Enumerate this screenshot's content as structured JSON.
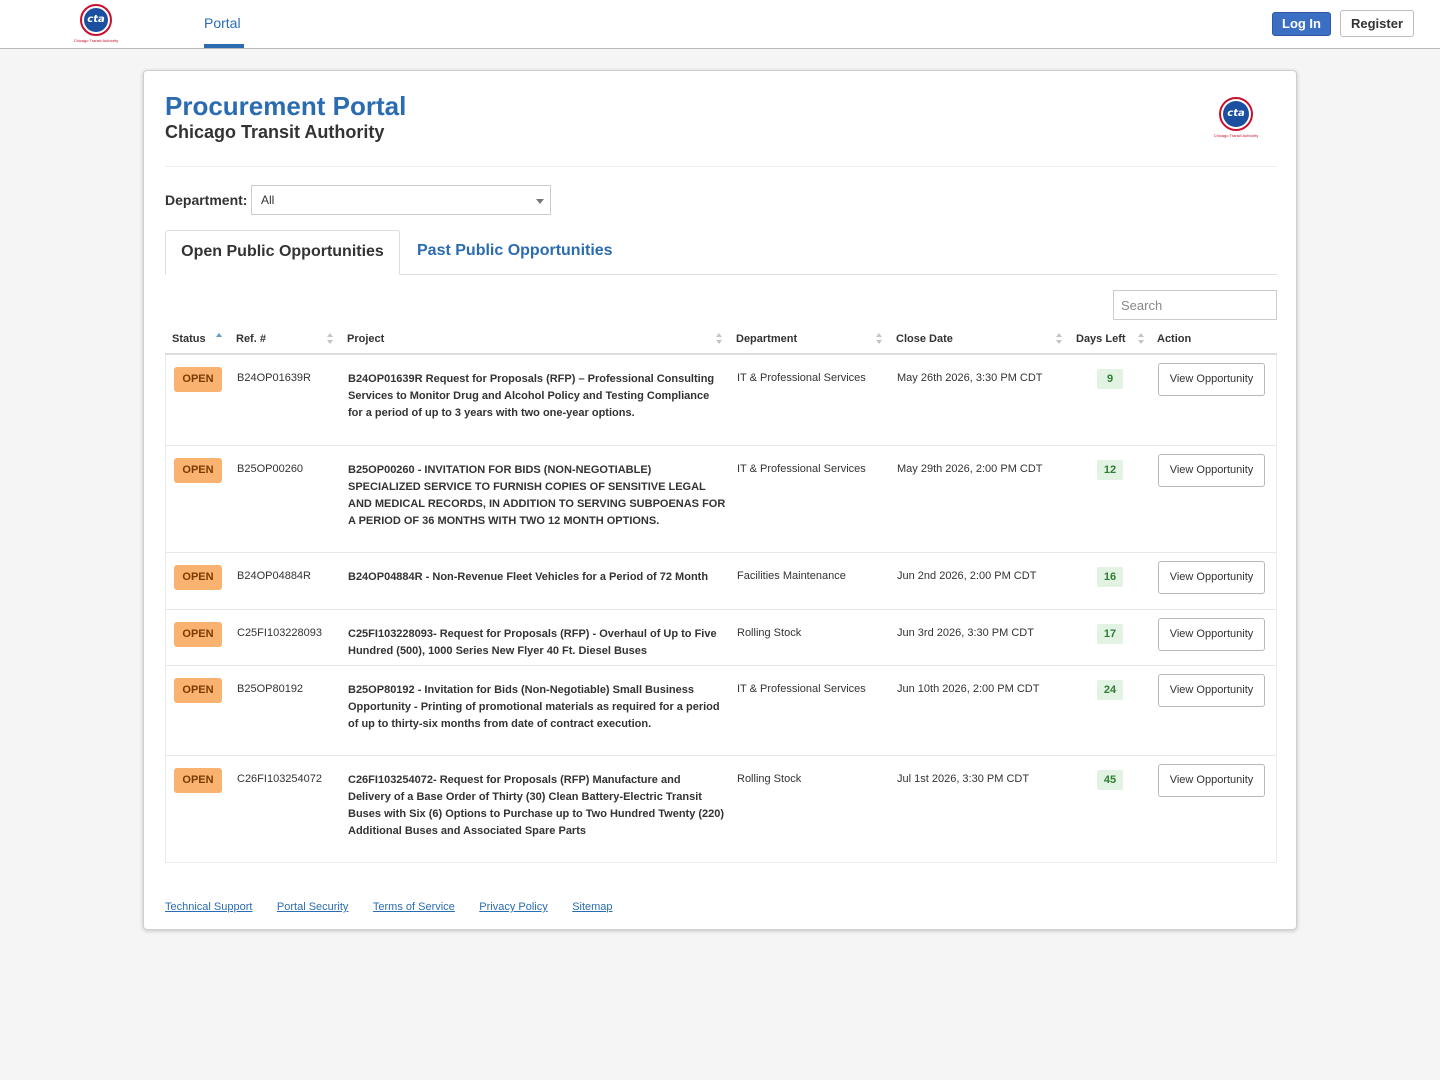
{
  "header": {
    "logo_text": "cta",
    "logo_caption": "Chicago Transit Authority",
    "nav_portal": "Portal",
    "login_label": "Log In",
    "register_label": "Register"
  },
  "page": {
    "title": "Procurement Portal",
    "subtitle": "Chicago Transit Authority"
  },
  "filter": {
    "department_label": "Department:",
    "department_value": "All"
  },
  "tabs": {
    "open": "Open Public Opportunities",
    "past": "Past Public Opportunities"
  },
  "search": {
    "placeholder": "Search"
  },
  "table": {
    "columns": {
      "status": "Status",
      "ref": "Ref. #",
      "project": "Project",
      "department": "Department",
      "close_date": "Close Date",
      "days_left": "Days Left",
      "action": "Action"
    },
    "rows": [
      {
        "status": "OPEN",
        "ref": "B24OP01639R",
        "project": "B24OP01639R Request for Proposals (RFP) – Professional Consulting Services to Monitor Drug and Alcohol Policy and Testing Compliance for a period of up to 3 years with two one-year options.",
        "department": "IT & Professional Services",
        "close_date": "May 26th 2026, 3:30 PM CDT",
        "days_left": "9",
        "action": "View Opportunity"
      },
      {
        "status": "OPEN",
        "ref": "B25OP00260",
        "project": "B25OP00260 - INVITATION FOR BIDS (NON-NEGOTIABLE) SPECIALIZED SERVICE TO FURNISH COPIES OF SENSITIVE LEGAL AND MEDICAL RECORDS, IN ADDITION TO SERVING SUBPOENAS FOR A PERIOD OF 36 MONTHS WITH TWO 12 MONTH OPTIONS.",
        "department": "IT & Professional Services",
        "close_date": "May 29th 2026, 2:00 PM CDT",
        "days_left": "12",
        "action": "View Opportunity"
      },
      {
        "status": "OPEN",
        "ref": "B24OP04884R",
        "project": "B24OP04884R - Non-Revenue Fleet Vehicles for a Period of 72 Month",
        "department": "Facilities Maintenance",
        "close_date": "Jun 2nd 2026, 2:00 PM CDT",
        "days_left": "16",
        "action": "View Opportunity"
      },
      {
        "status": "OPEN",
        "ref": "C25FI103228093",
        "project": "C25FI103228093- Request for Proposals (RFP) - Overhaul of Up to Five Hundred (500), 1000 Series New Flyer 40 Ft. Diesel Buses",
        "department": "Rolling Stock",
        "close_date": "Jun 3rd 2026, 3:30 PM CDT",
        "days_left": "17",
        "action": "View Opportunity"
      },
      {
        "status": "OPEN",
        "ref": "B25OP80192",
        "project": "B25OP80192 - Invitation for Bids (Non-Negotiable) Small Business Opportunity - Printing of promotional materials as required for a period of up to thirty-six months from date of contract execution.",
        "department": "IT & Professional Services",
        "close_date": "Jun 10th 2026, 2:00 PM CDT",
        "days_left": "24",
        "action": "View Opportunity"
      },
      {
        "status": "OPEN",
        "ref": "C26FI103254072",
        "project": "C26FI103254072- Request for Proposals (RFP) Manufacture and Delivery of a Base Order of Thirty (30) Clean Battery-Electric Transit Buses with Six (6) Options to Purchase up to Two Hundred Twenty (220) Additional Buses and Associated Spare Parts",
        "department": "Rolling Stock",
        "close_date": "Jul 1st 2026, 3:30 PM CDT",
        "days_left": "45",
        "action": "View Opportunity"
      }
    ]
  },
  "footer": {
    "links": [
      "Technical Support",
      "Portal Security",
      "Terms of Service",
      "Privacy Policy",
      "Sitemap"
    ]
  },
  "colors": {
    "brand_blue": "#2b6cb0",
    "login_blue": "#3b6fc4",
    "open_badge": "#f9b26f",
    "days_badge_bg": "#e3f3e3",
    "days_badge_text": "#2e7d32",
    "cta_red": "#c8102e"
  }
}
